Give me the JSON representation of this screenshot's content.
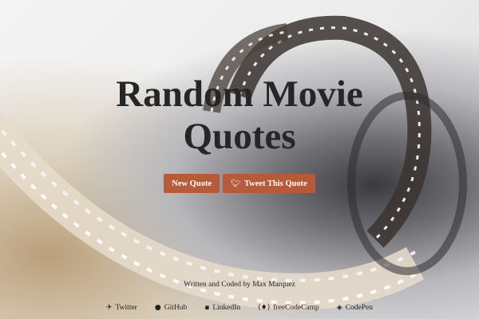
{
  "header": {
    "title_line1": "Random Movie",
    "title_line2": "Quotes"
  },
  "actions": {
    "new_quote_label": "New Quote",
    "tweet_label": "Tweet This Quote",
    "tweet_icon": "twitter-icon",
    "button_color": "#b7593b"
  },
  "footer": {
    "credit": "Written and Coded by Max Marquez",
    "links": [
      {
        "label": "Twitter",
        "icon": "twitter-icon"
      },
      {
        "label": "GitHub",
        "icon": "github-icon"
      },
      {
        "label": "LinkedIn",
        "icon": "linkedin-icon"
      },
      {
        "label": "freeCodeCamp",
        "icon": "freecodecamp-icon"
      },
      {
        "label": "CodePen",
        "icon": "codepen-icon"
      }
    ]
  }
}
